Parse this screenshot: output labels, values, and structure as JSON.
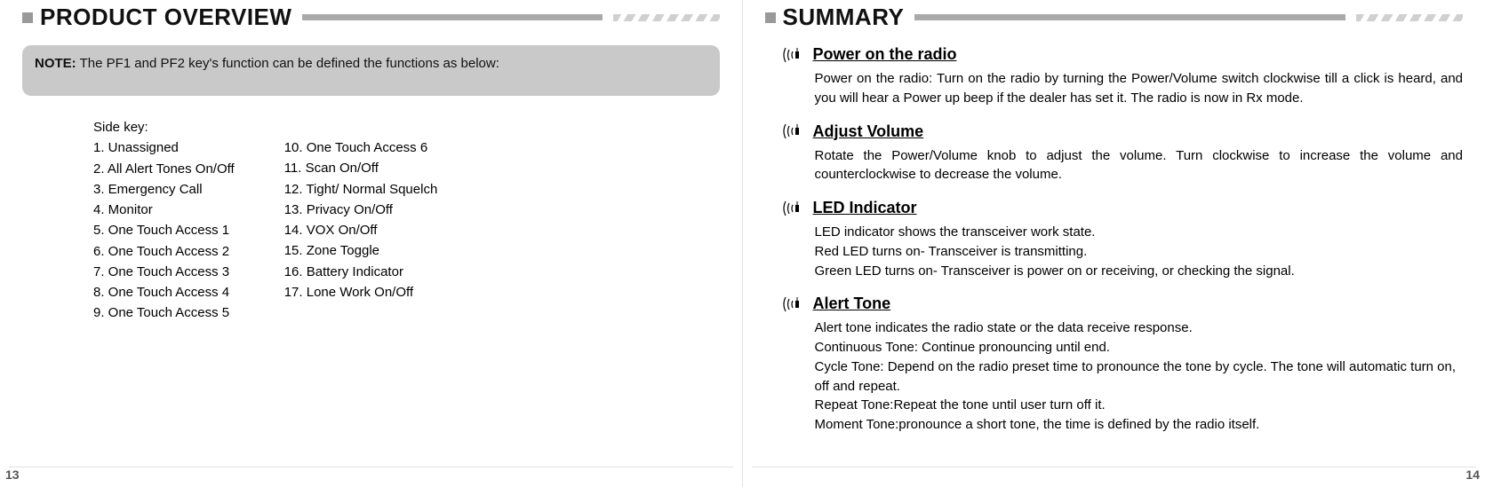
{
  "left": {
    "section_title": "PRODUCT OVERVIEW",
    "note_label": "NOTE:",
    "note_text": "  The PF1 and PF2 key's function can be defined the functions as below:",
    "side_key_label": "Side key:",
    "col1": [
      "1.   Unassigned",
      "2.   All Alert Tones On/Off",
      "3.  Emergency Call",
      "4.   Monitor",
      "5.   One Touch Access 1",
      "6.   One Touch Access  2",
      "7.   One Touch Access  3",
      "8.   One Touch Access  4",
      "9.   One Touch Access  5"
    ],
    "col2": [
      "10. One Touch Access  6",
      "11. Scan On/Off",
      "12. Tight/ Normal Squelch",
      "13. Privacy On/Off",
      "14. VOX On/Off",
      "15. Zone Toggle",
      "16. Battery Indicator",
      "17. Lone Work On/Off"
    ],
    "page_num": "13"
  },
  "right": {
    "section_title": "SUMMARY",
    "sections": [
      {
        "title": "Power on the radio",
        "body": "Power on the radio: Turn on the radio by turning the Power/Volume switch clockwise till a click is heard, and you will hear a Power up beep if the dealer has set it. The radio is now in Rx mode."
      },
      {
        "title": "Adjust Volume",
        "body": "Rotate the Power/Volume knob to adjust the volume. Turn clockwise to increase the volume and counterclockwise to decrease the volume."
      },
      {
        "title": "LED Indicator",
        "body": "LED indicator shows the transceiver work state.\nRed LED turns on- Transceiver is transmitting.\nGreen LED turns on- Transceiver is power on or receiving, or checking the signal."
      },
      {
        "title": "Alert Tone",
        "body": "Alert tone  indicates the radio state or the data  receive response.\nContinuous Tone: Continue pronouncing until end.\nCycle Tone: Depend on the radio preset time to pronounce the tone by cycle. The tone will automatic turn on, off and repeat.\nRepeat Tone:Repeat the tone until user turn off it.\nMoment Tone:pronounce a short tone, the time is defined by the radio itself."
      }
    ],
    "page_num": "14"
  }
}
